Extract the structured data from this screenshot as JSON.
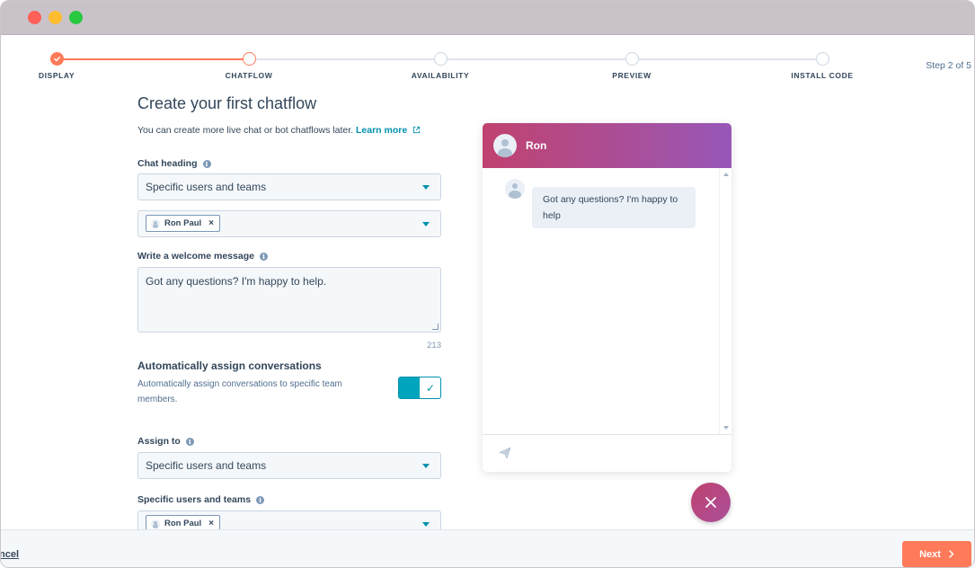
{
  "steps": [
    {
      "label": "DISPLAY",
      "state": "done"
    },
    {
      "label": "CHATFLOW",
      "state": "current"
    },
    {
      "label": "AVAILABILITY",
      "state": "todo"
    },
    {
      "label": "PREVIEW",
      "state": "todo"
    },
    {
      "label": "INSTALL CODE",
      "state": "todo"
    }
  ],
  "step_count": "Step 2 of 5",
  "form": {
    "title": "Create your first chatflow",
    "subtitle": "You can create more live chat or bot chatflows later.",
    "learn_more": "Learn more",
    "chat_heading_label": "Chat heading",
    "chat_heading_value": "Specific users and teams",
    "chat_heading_user": "Ron Paul",
    "welcome_label": "Write a welcome message",
    "welcome_value": "Got any questions? I'm happy to help.",
    "char_count": "213",
    "assign_title": "Automatically assign conversations",
    "assign_desc": "Automatically assign conversations to specific team members.",
    "assign_toggle": "on",
    "assign_to_label": "Assign to",
    "assign_to_value": "Specific users and teams",
    "specific_label": "Specific users and teams",
    "specific_user": "Ron Paul"
  },
  "chat": {
    "agent_name": "Ron",
    "message": "Got any questions? I'm happy to help",
    "header_gradient": [
      "#c0426f",
      "#9757b8"
    ]
  },
  "footer": {
    "cancel": "ncel",
    "next": "Next"
  },
  "colors": {
    "accent": "#ff7a59",
    "teal": "#00a4bd",
    "link": "#0091ae"
  }
}
